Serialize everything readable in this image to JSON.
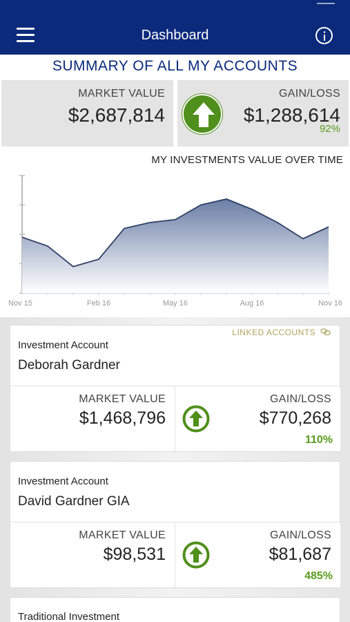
{
  "header": {
    "title": "Dashboard"
  },
  "summary": {
    "title": "SUMMARY OF ALL MY ACCOUNTS",
    "market_value_label": "MARKET VALUE",
    "market_value": "$2,687,814",
    "gain_loss_label": "GAIN/LOSS",
    "gain_loss": "$1,288,614",
    "gain_loss_pct": "92%"
  },
  "chart": {
    "title": "MY INVESTMENTS VALUE OVER TIME",
    "x_ticks": [
      "Nov 15",
      "Feb 16",
      "May 16",
      "Aug 16",
      "Nov 16"
    ]
  },
  "chart_data": {
    "type": "area",
    "title": "MY INVESTMENTS VALUE OVER TIME",
    "x": [
      "Nov 15",
      "Dec 15",
      "Jan 16",
      "Feb 16",
      "Mar 16",
      "Apr 16",
      "May 16",
      "Jun 16",
      "Jul 16",
      "Aug 16",
      "Sep 16",
      "Oct 16",
      "Nov 16"
    ],
    "values": [
      1.9,
      1.6,
      0.9,
      1.15,
      2.2,
      2.4,
      2.5,
      3.0,
      3.2,
      2.85,
      2.4,
      1.85,
      2.25
    ],
    "ylim": [
      0,
      4
    ],
    "xlabel": "",
    "ylabel": "",
    "grid": false
  },
  "accounts": [
    {
      "linked_label": "LINKED ACCOUNTS",
      "type": "Investment Account",
      "name": "Deborah Gardner",
      "market_value_label": "MARKET VALUE",
      "market_value": "$1,468,796",
      "gain_loss_label": "GAIN/LOSS",
      "gain_loss": "$770,268",
      "gain_loss_pct": "110%"
    },
    {
      "type": "Investment Account",
      "name": "David Gardner GIA",
      "market_value_label": "MARKET VALUE",
      "market_value": "$98,531",
      "gain_loss_label": "GAIN/LOSS",
      "gain_loss": "$81,687",
      "gain_loss_pct": "485%"
    },
    {
      "type": "Traditional Investment"
    }
  ],
  "colors": {
    "nav_bg": "#0b2a7c",
    "gain_green": "#4f8f1b",
    "pct_green": "#5a9a1e",
    "linked_gold": "#b0a35f"
  },
  "icons": {
    "menu": "hamburger-menu-icon",
    "info": "info-icon",
    "gain": "up-arrow-icon",
    "linked": "link-icon"
  }
}
